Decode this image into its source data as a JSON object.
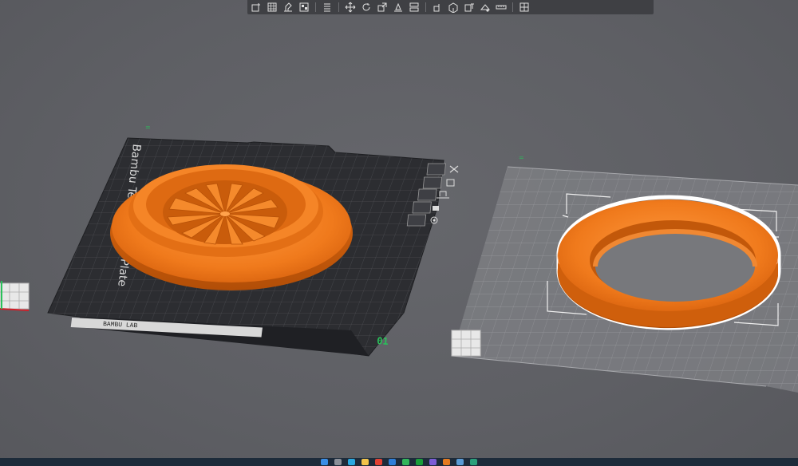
{
  "toolbar": {
    "groups": [
      [
        "add-object",
        "add-plate",
        "auto-orient",
        "arrange"
      ],
      [
        "split",
        "layers"
      ],
      [
        "move",
        "rotate",
        "scale",
        "lay-on-face"
      ],
      [
        "cut",
        "boolean"
      ],
      [
        "support-paint",
        "seam-paint",
        "text",
        "measure"
      ],
      [
        "assembly"
      ]
    ]
  },
  "scene": {
    "plate1": {
      "label": "Bambu Textured PEI Plate",
      "number": "01",
      "bottom_text": "BAMBU LAB",
      "object_color": "#f07a1c"
    },
    "plate2": {
      "object_color": "#f07a1c"
    },
    "plate_tools": [
      "close-plate",
      "arrange-plate",
      "orient-plate",
      "lock-plate",
      "settings-plate"
    ]
  },
  "colors": {
    "background": "#5e5f64",
    "bed": "#2c2d31",
    "orange": "#f07a1c",
    "green": "#29c15a"
  }
}
